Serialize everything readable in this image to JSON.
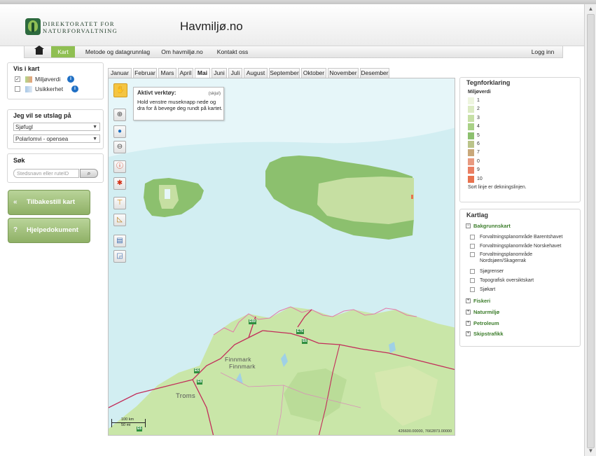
{
  "header": {
    "logo_line1": "DIREKTORATET FOR",
    "logo_line2": "NATURFORVALTNING",
    "site_title": "Havmiljø.no"
  },
  "nav": {
    "home_icon": "home-icon",
    "items": [
      {
        "label": "Kart",
        "active": true
      },
      {
        "label": "Metode og datagrunnlag"
      },
      {
        "label": "Om havmiljø.no"
      },
      {
        "label": "Kontakt oss"
      }
    ],
    "login": "Logg inn"
  },
  "vis_i_kart": {
    "title": "Vis i kart",
    "layers": [
      {
        "label": "Miljøverdi",
        "checked": true
      },
      {
        "label": "Usikkerhet",
        "checked": false
      }
    ]
  },
  "utslag": {
    "title": "Jeg vil se utslag på",
    "select1": "Sjøfugl",
    "select2": "Polarlomvi - opensea"
  },
  "search": {
    "title": "Søk",
    "placeholder": "Stedsnavn eller ruteID"
  },
  "buttons": {
    "reset": "Tilbakestill kart",
    "reset_icon": "«",
    "help": "Hjelpedokument",
    "help_icon": "?"
  },
  "months": [
    "Januar",
    "Februar",
    "Mars",
    "April",
    "Mai",
    "Juni",
    "Juli",
    "August",
    "September",
    "Oktober",
    "November",
    "Desember"
  ],
  "active_month": "Mai",
  "tool_tooltip": {
    "title": "Aktivt verktøy:",
    "close": "(skjul)",
    "text": "Hold venstre museknapp nede og dra for å bevege deg rundt på kartet."
  },
  "map": {
    "labels": {
      "finnmark1": "Finnmark",
      "finnmark2": "Finnmark",
      "troms": "Troms"
    },
    "roads": [
      "E69",
      "E75",
      "E6",
      "E6",
      "E8",
      "E6"
    ],
    "scale_km": "100 km",
    "scale_mi": "50 mi",
    "coords": "426600.00000, 7662873.00000",
    "colors": {
      "sea": "#d2eef2",
      "sea_light": "#e6f6f9",
      "land": "#c9e6a8",
      "env_high": "#8cc06e",
      "env_low": "#c6dfa2"
    }
  },
  "legend": {
    "title": "Tegnforklaring",
    "subtitle": "Miljøverdi",
    "items": [
      {
        "label": "1",
        "color": "#eef5df"
      },
      {
        "label": "2",
        "color": "#dcebc3"
      },
      {
        "label": "3",
        "color": "#c7e0a6"
      },
      {
        "label": "4",
        "color": "#a9d186"
      },
      {
        "label": "5",
        "color": "#8cc06e"
      },
      {
        "label": "6",
        "color": "#bbc48a"
      },
      {
        "label": "7",
        "color": "#c9a87a"
      },
      {
        "label": "0",
        "color": "#e89a80"
      },
      {
        "label": "9",
        "color": "#ea7f63"
      },
      {
        "label": "10",
        "color": "#e8734f"
      }
    ],
    "note": "Sort linje er dekningslinjen."
  },
  "kartlag": {
    "title": "Kartlag",
    "groups": [
      {
        "label": "Bakgrunnskart",
        "expanded": true
      },
      {
        "label": "Fiskeri"
      },
      {
        "label": "Naturmiljø"
      },
      {
        "label": "Petroleum"
      },
      {
        "label": "Skipstrafikk"
      }
    ],
    "bakgrunn_items": [
      "Forvaltningsplanområde Barentshavet",
      "Forvaltningsplanområde Norskehavet",
      "Forvaltningsplanområde Nordsjøen/Skagerrak",
      "Sjøgrenser",
      "Topografisk oversiktskart",
      "Sjøkart"
    ]
  }
}
